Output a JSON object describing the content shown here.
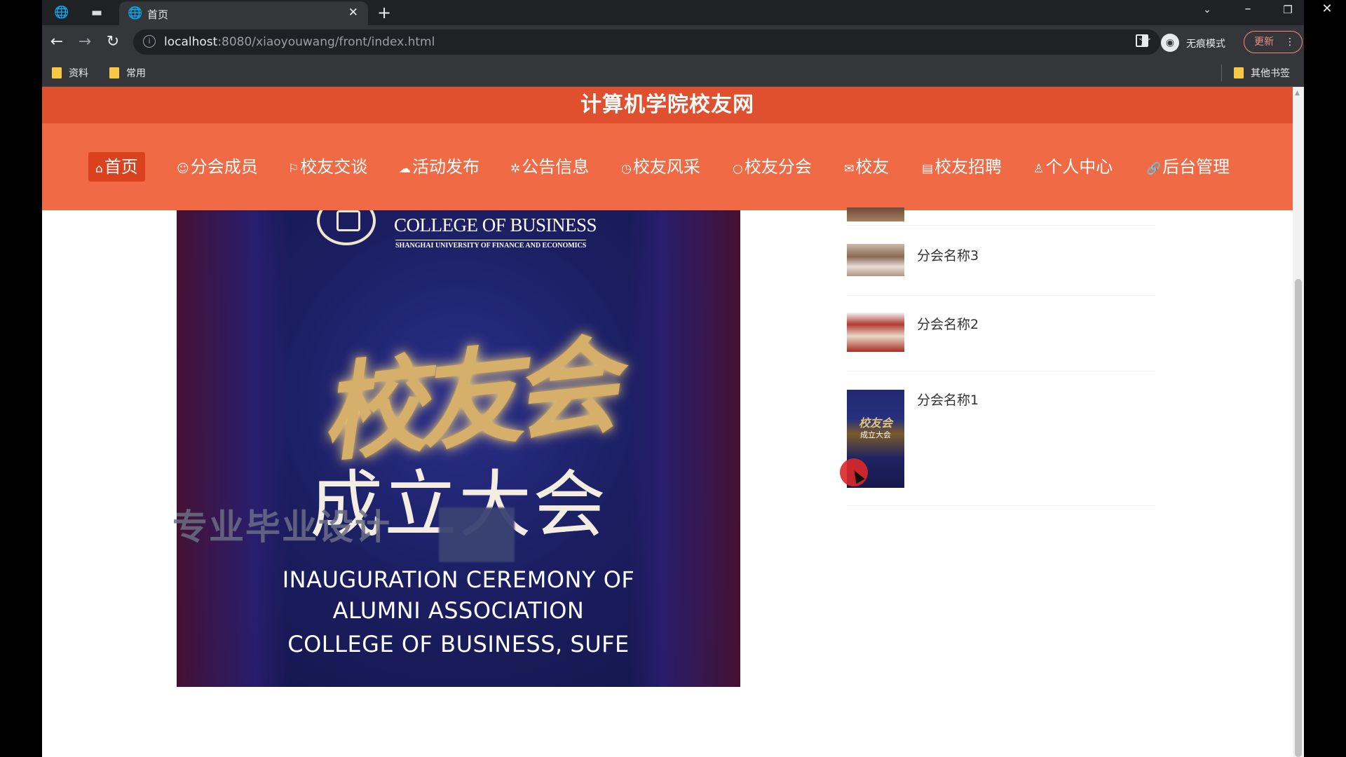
{
  "browser": {
    "tab_title": "首页",
    "url_host": "localhost",
    "url_rest": ":8080/xiaoyouwang/front/index.html",
    "incognito_label": "无痕模式",
    "update_label": "更新",
    "bookmarks": [
      "资料",
      "常用"
    ],
    "other_bookmarks": "其他书签"
  },
  "site": {
    "title": "计算机学院校友网",
    "nav": [
      {
        "icon": "⌂",
        "label": "首页"
      },
      {
        "icon": "☺",
        "label": "分会成员"
      },
      {
        "icon": "⚐",
        "label": "校友交谈"
      },
      {
        "icon": "☁",
        "label": "活动发布"
      },
      {
        "icon": "✲",
        "label": "公告信息"
      },
      {
        "icon": "◷",
        "label": "校友风采"
      },
      {
        "icon": "○",
        "label": "校友分会"
      },
      {
        "icon": "✉",
        "label": "校友"
      },
      {
        "icon": "▤",
        "label": "校友招聘"
      },
      {
        "icon": "♙",
        "label": "个人中心"
      },
      {
        "icon": "🔗",
        "label": "后台管理"
      }
    ]
  },
  "banner": {
    "college": "COLLEGE OF BUSINESS",
    "college_sub": "SHANGHAI UNIVERSITY OF FINANCE AND ECONOMICS",
    "calligraphy": "校友会",
    "ceremony": "成立大会",
    "english_line1": "INAUGURATION CEREMONY OF",
    "english_line2": "ALUMNI ASSOCIATION",
    "english_line3": "COLLEGE OF BUSINESS, SUFE",
    "watermark": "专业毕业设计"
  },
  "branches": [
    {
      "name": "分会名称3"
    },
    {
      "name": "分会名称2"
    },
    {
      "name": "分会名称1"
    }
  ],
  "branch_thumb_text": {
    "big": "校友会",
    "small": "成立大会"
  }
}
